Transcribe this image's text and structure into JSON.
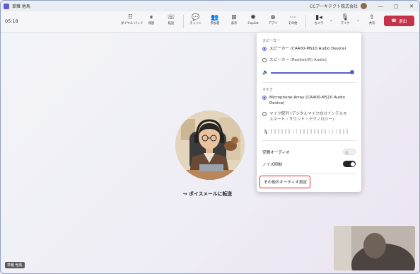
{
  "window": {
    "title": "草薙 他馬",
    "org": "CCアーキテクト株式会社",
    "minimize": "—",
    "maximize": "▢",
    "close": "✕"
  },
  "toolbar": {
    "timer": "05:18",
    "items": [
      {
        "label": "ダイヤル パッド",
        "icon": "dialpad-icon",
        "glyph": "⠿"
      },
      {
        "label": "保留",
        "icon": "pause-icon",
        "glyph": "⏸"
      },
      {
        "label": "転送",
        "icon": "transfer-icon",
        "glyph": "☏"
      },
      {
        "label": "チャット",
        "icon": "chat-icon",
        "glyph": "💬"
      },
      {
        "label": "参加者",
        "icon": "people-icon",
        "glyph": "👥"
      },
      {
        "label": "表示",
        "icon": "view-icon",
        "glyph": "⊞"
      },
      {
        "label": "Copilot",
        "icon": "copilot-icon",
        "glyph": "✺"
      },
      {
        "label": "アプリ",
        "icon": "apps-icon",
        "glyph": "⊕"
      },
      {
        "label": "その他",
        "icon": "more-icon",
        "glyph": "⋯"
      },
      {
        "label": "カメラ",
        "icon": "camera-icon",
        "glyph": "▮◂"
      },
      {
        "label": "マイク",
        "icon": "mic-icon",
        "glyph": "🎙"
      },
      {
        "label": "共有",
        "icon": "share-icon",
        "glyph": "⇧"
      }
    ],
    "leave_label": "退出"
  },
  "main": {
    "voicemail_label": "ボイスメールに転送",
    "caller_name": "草薙 他馬"
  },
  "audio_panel": {
    "speaker_title": "スピーカー",
    "speakers": [
      {
        "label": "スピーカー (CA400-MS10 Audio Device)",
        "selected": true
      },
      {
        "label": "スピーカー (Realtek(R) Audio)",
        "selected": false
      }
    ],
    "speaker_volume": 1.0,
    "mic_title": "マイク",
    "mics": [
      {
        "label": "Microphone Array (CA400-MS10 Audio Device)",
        "selected": true
      },
      {
        "label": "マイク配列 (デジタルマイク向けインテル® スマート・サウンド・テクノロジー)",
        "selected": false
      }
    ],
    "spatial_audio_label": "空間オーディオ",
    "spatial_audio_on": false,
    "noise_suppression_label": "ノイズ抑制",
    "noise_suppression_on": true,
    "more_audio_settings_label": "その他のオーディオ設定"
  },
  "colors": {
    "accent": "#5b5fc7",
    "leave": "#c4314b",
    "highlight_box": "#e0272b"
  }
}
